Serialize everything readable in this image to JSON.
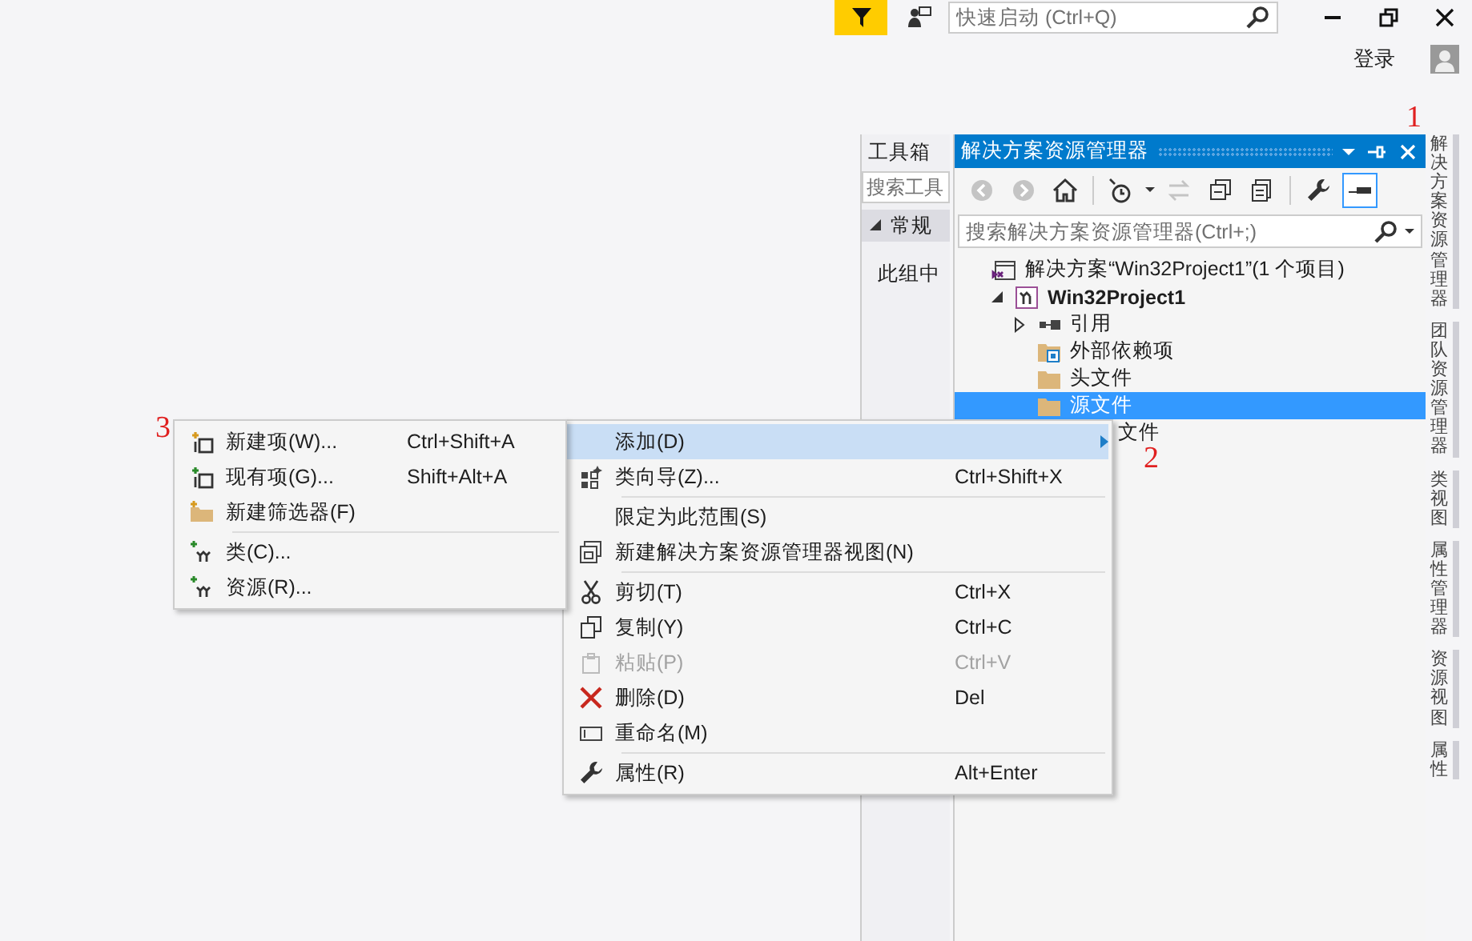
{
  "title_bar": {
    "quick_launch": {
      "placeholder": "快速启动 (Ctrl+Q)"
    },
    "sign_in": "登录"
  },
  "toolbox": {
    "title": "工具箱",
    "search": {
      "placeholder": "搜索工具"
    },
    "group": {
      "label": "常规",
      "expanded": true
    },
    "empty_text": "此组中"
  },
  "solution_explorer": {
    "title": "解决方案资源管理器",
    "search": {
      "placeholder": "搜索解决方案资源管理器(Ctrl+;)"
    },
    "toolbar": [
      {
        "kind": "back",
        "disabled": true,
        "selected": false
      },
      {
        "kind": "forward",
        "disabled": true,
        "selected": false
      },
      {
        "kind": "home",
        "disabled": false,
        "selected": false
      },
      {
        "kind": "history",
        "disabled": false,
        "selected": false
      },
      {
        "kind": "sync",
        "disabled": true,
        "selected": false
      },
      {
        "kind": "collapse",
        "disabled": false,
        "selected": false
      },
      {
        "kind": "files",
        "disabled": false,
        "selected": false
      },
      {
        "kind": "properties",
        "disabled": false,
        "selected": false
      },
      {
        "kind": "preview",
        "disabled": false,
        "selected": true
      }
    ],
    "tree": [
      {
        "label": "解决方案“Win32Project1”(1 个项目)",
        "kind": "solution",
        "selected": false,
        "children": [
          {
            "label": "Win32Project1",
            "kind": "project",
            "selected": false,
            "expanded": true,
            "children": [
              {
                "label": "引用",
                "kind": "references",
                "selected": false,
                "expanded": false
              },
              {
                "label": "外部依赖项",
                "kind": "dependencies",
                "selected": false
              },
              {
                "label": "头文件",
                "kind": "filter",
                "selected": false
              },
              {
                "label": "源文件",
                "kind": "filter",
                "selected": true
              },
              {
                "label": "文件",
                "kind": "filter",
                "selected": false,
                "partly_covered": true
              }
            ]
          }
        ]
      }
    ]
  },
  "side_tabs": [
    "解决方案资源管理器",
    "团队资源管理器",
    "类视图",
    "属性管理器",
    "资源视图",
    "属性"
  ],
  "context_menu": [
    {
      "kind": "item",
      "label": "添加(D)",
      "selected": true,
      "disabled": false,
      "submenu": true
    },
    {
      "kind": "item",
      "label": "类向导(Z)...",
      "shortcut": "Ctrl+Shift+X",
      "selected": false,
      "disabled": false,
      "submenu": false
    },
    {
      "kind": "separator"
    },
    {
      "kind": "item",
      "label": "限定为此范围(S)",
      "selected": false,
      "disabled": false,
      "submenu": false
    },
    {
      "kind": "item",
      "label": "新建解决方案资源管理器视图(N)",
      "selected": false,
      "disabled": false,
      "submenu": false
    },
    {
      "kind": "separator"
    },
    {
      "kind": "item",
      "label": "剪切(T)",
      "shortcut": "Ctrl+X",
      "selected": false,
      "disabled": false,
      "submenu": false
    },
    {
      "kind": "item",
      "label": "复制(Y)",
      "shortcut": "Ctrl+C",
      "selected": false,
      "disabled": false,
      "submenu": false
    },
    {
      "kind": "item",
      "label": "粘贴(P)",
      "shortcut": "Ctrl+V",
      "selected": false,
      "disabled": true,
      "submenu": false
    },
    {
      "kind": "item",
      "label": "删除(D)",
      "shortcut": "Del",
      "selected": false,
      "disabled": false,
      "submenu": false
    },
    {
      "kind": "item",
      "label": "重命名(M)",
      "selected": false,
      "disabled": false,
      "submenu": false
    },
    {
      "kind": "separator"
    },
    {
      "kind": "item",
      "label": "属性(R)",
      "shortcut": "Alt+Enter",
      "selected": false,
      "disabled": false,
      "submenu": false
    }
  ],
  "submenu": [
    {
      "kind": "item",
      "label": "新建项(W)...",
      "shortcut": "Ctrl+Shift+A",
      "selected": false,
      "disabled": false,
      "submenu": false
    },
    {
      "kind": "item",
      "label": "现有项(G)...",
      "shortcut": "Shift+Alt+A",
      "selected": false,
      "disabled": false,
      "submenu": false
    },
    {
      "kind": "item",
      "label": "新建筛选器(F)",
      "selected": false,
      "disabled": false,
      "submenu": false
    },
    {
      "kind": "separator"
    },
    {
      "kind": "item",
      "label": "类(C)...",
      "selected": false,
      "disabled": false,
      "submenu": false
    },
    {
      "kind": "item",
      "label": "资源(R)...",
      "selected": false,
      "disabled": false,
      "submenu": false
    }
  ],
  "annotations": [
    "1",
    "2",
    "3"
  ]
}
